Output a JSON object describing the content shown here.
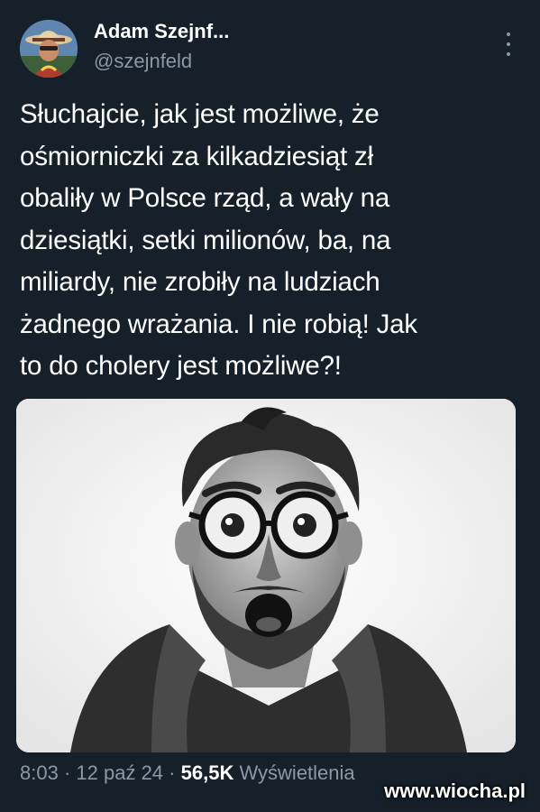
{
  "author": {
    "display_name": "Adam Szejnf...",
    "handle": "@szejnfeld",
    "avatar_icon": "avatar-photo"
  },
  "tweet": {
    "lines": [
      "Słuchajcie, jak jest możliwe, że",
      "ośmiorniczki za kilkadziesiąt zł",
      "obaliły w Polsce rząd, a wały na",
      "dziesiątki, setki milionów, ba, na",
      "miliardy, nie zrobiły na ludziach",
      "żadnego wrażania. I nie robią! Jak",
      "to do cholery jest możliwe?!"
    ]
  },
  "media": {
    "icon": "shocked-man-photo"
  },
  "meta": {
    "time": "8:03",
    "sep1": "·",
    "date": "12 paź 24",
    "sep2": "·",
    "views_count": "56,5K",
    "views_label": "Wyświetlenia"
  },
  "watermark": {
    "text": "www.wiocha.pl"
  },
  "colors": {
    "background": "#15202b",
    "text": "#ffffff",
    "secondary": "#8b98a5"
  }
}
